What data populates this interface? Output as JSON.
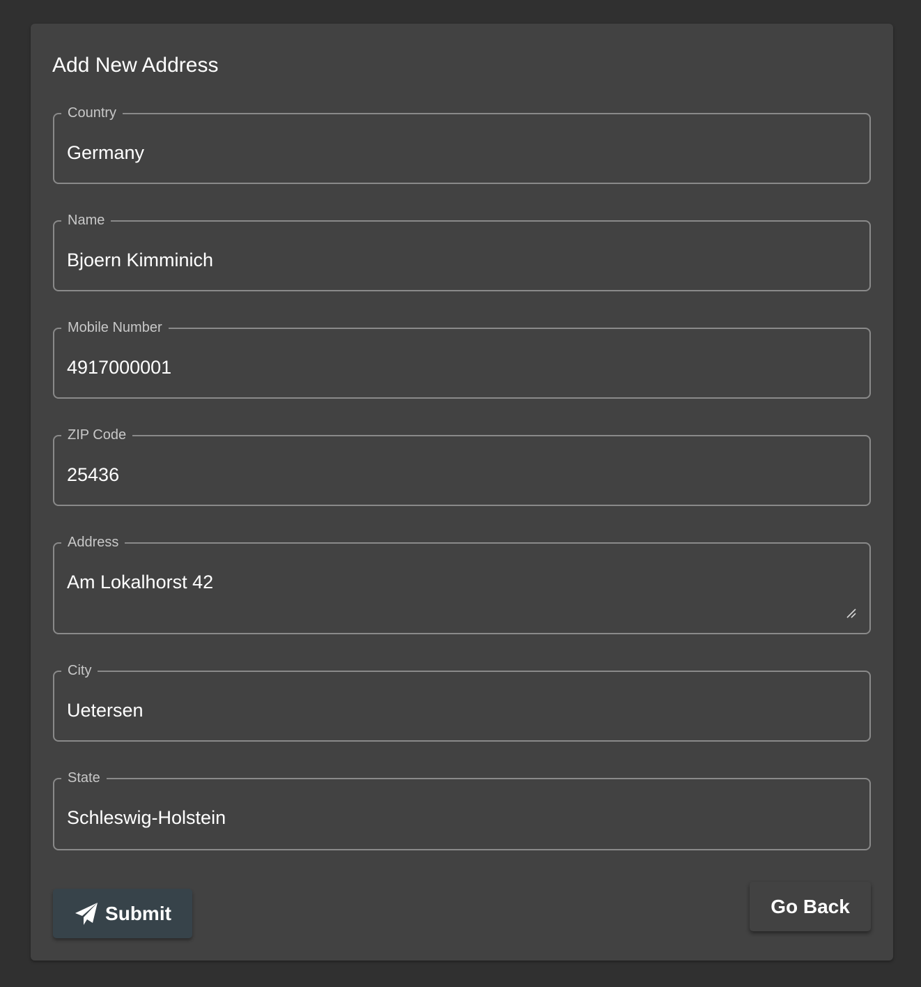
{
  "form": {
    "title": "Add New Address",
    "fields": [
      {
        "label": "Country",
        "value": "Germany"
      },
      {
        "label": "Name",
        "value": "Bjoern Kimminich"
      },
      {
        "label": "Mobile Number",
        "value": "4917000001"
      },
      {
        "label": "ZIP Code",
        "value": "25436"
      },
      {
        "label": "Address",
        "value": "Am Lokalhorst 42"
      },
      {
        "label": "City",
        "value": "Uetersen"
      },
      {
        "label": "State",
        "value": "Schleswig-Holstein"
      }
    ],
    "icons": {
      "submit": "send-icon",
      "address_resize": "resize-handle-icon"
    },
    "submit_label": "Submit",
    "back_label": "Go Back"
  },
  "colors": {
    "page_background": "#303030",
    "card_background": "#424242",
    "field_border": "#8a8a8a",
    "submit_button": "#37434a"
  }
}
